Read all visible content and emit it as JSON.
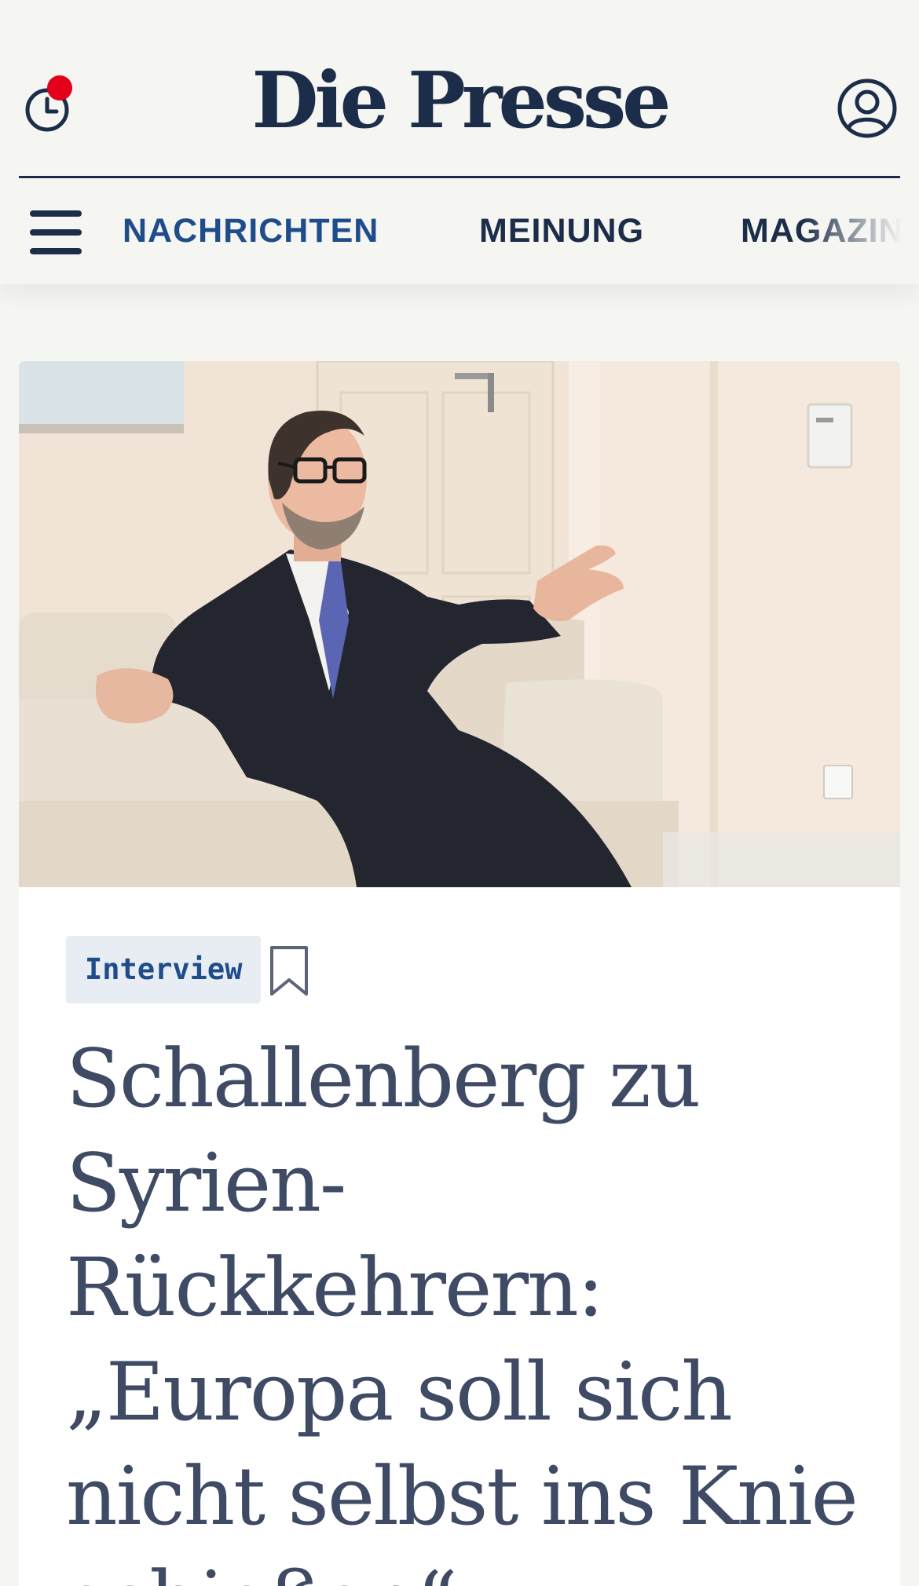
{
  "header": {
    "logo": "Die Presse",
    "history_icon": "clock-icon",
    "account_icon": "user-circle-icon",
    "menu_icon": "hamburger-menu-icon"
  },
  "nav": {
    "items": [
      {
        "label": "NACHRICHTEN",
        "active": true
      },
      {
        "label": "MEINUNG",
        "active": false
      },
      {
        "label": "MAGAZIN",
        "active": false
      }
    ]
  },
  "article": {
    "image_description_icon": "article-photo",
    "tag": "Interview",
    "bookmark_icon": "bookmark-icon",
    "headline": "Schallenberg zu Syrien-Rückkehrern: „Europa soll sich nicht selbst ins Knie schießen“"
  },
  "colors": {
    "brand_navy": "#1c2d4a",
    "nav_active": "#1f4c8a",
    "notification_dot": "#e2001a",
    "headline": "#3f4a65",
    "tag_background": "#e8edf3",
    "page_background": "#f5f5f1"
  }
}
